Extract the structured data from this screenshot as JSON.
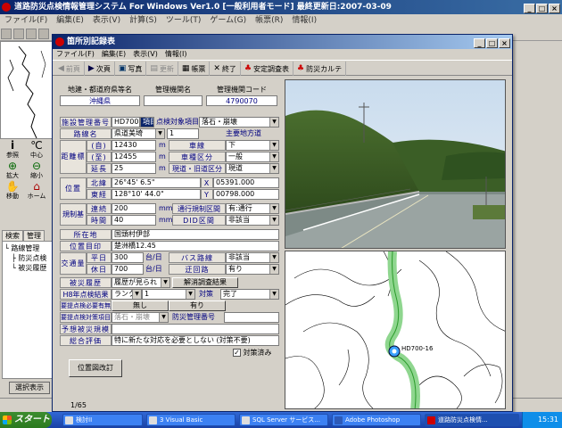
{
  "main_window": {
    "title": "道路防災点検情報管理システム For Windows Ver1.0 [一般利用者モード]  最終更新日:2007-03-09",
    "menu": [
      "ファイル(F)",
      "編集(E)",
      "表示(V)",
      "計算(S)",
      "ツール(T)",
      "ゲーム(G)",
      "帳票(R)",
      "情報(I)"
    ],
    "tools": [
      {
        "label": "参照",
        "icon": "info-icon"
      },
      {
        "label": "中心",
        "icon": "center-icon"
      },
      {
        "label": "拡大",
        "icon": "zoom-in-icon"
      },
      {
        "label": "縮小",
        "icon": "zoom-out-icon"
      },
      {
        "label": "移動",
        "icon": "pan-icon"
      },
      {
        "label": "ホーム",
        "icon": "home-icon"
      }
    ],
    "tree_tabs": [
      "検索",
      "管理"
    ],
    "tree_items": [
      "└ 路線管理",
      "　├ 防災点検",
      "　└ 被災履歴"
    ],
    "bottom_button": "選択表示"
  },
  "dialog": {
    "title": "箇所別記録表",
    "menu": [
      "ファイル(F)",
      "編集(E)",
      "表示(V)",
      "情報(I)"
    ],
    "toolbar": [
      {
        "label": "前頁",
        "icon": "prev-icon",
        "enabled": false
      },
      {
        "label": "次頁",
        "icon": "next-icon",
        "enabled": true
      },
      {
        "label": "写真",
        "icon": "photo-icon",
        "enabled": true
      },
      {
        "label": "更新",
        "icon": "update-icon",
        "enabled": false
      },
      {
        "label": "帳票",
        "icon": "report-icon",
        "enabled": true
      },
      {
        "label": "終了",
        "icon": "close-x-icon",
        "enabled": true
      },
      {
        "label": "安定調査表",
        "icon": "survey-icon",
        "enabled": true
      },
      {
        "label": "防災カルテ",
        "icon": "karte-icon",
        "enabled": true
      }
    ],
    "header": {
      "labels": [
        "地建・都道府県等名",
        "管理機関名",
        "管理機関コード"
      ],
      "values": [
        "沖縄県",
        "",
        "4790070"
      ]
    },
    "form": {
      "facility_no_label": "施設管理番号",
      "facility_no": "HD700",
      "facility_sub": "項目",
      "target_label": "点検対象項目",
      "target_value": "落石・崩壊",
      "route_label": "路線名",
      "route_value": "県道美埼",
      "route_num": "1",
      "main_local": "主要地方道",
      "dist_label": "距離標",
      "dist_from_label": "(自)",
      "dist_from": "12430",
      "dist_to_label": "(至)",
      "dist_to": "12455",
      "length_label": "延長",
      "length": "25",
      "unit_m": "m",
      "lane_label": "車線",
      "lane_value": "下",
      "type_label": "車種区分",
      "type_value": "一般",
      "up_down_label": "現道・旧道区分",
      "up_down_value": "現道",
      "pos_label": "位置",
      "lat_label": "北緯",
      "lat_value": "26°45' 6.5\"",
      "lon_label": "東経",
      "lon_value": "128°10' 44.0\"",
      "x_label": "X",
      "x_value": "05391.000",
      "y_label": "Y",
      "y_value": "00798.000",
      "reg_label": "規制基準",
      "rain_label": "連続",
      "rain_value": "200",
      "unit_mm": "mm",
      "time_label": "時間",
      "time_value": "40",
      "reg_section_label": "通行規制区間",
      "reg_section_value": "有:通行",
      "did_label": "DID区間",
      "did_value": "非該当",
      "location_label": "所在地",
      "location_value": "国頭村伊部",
      "place_label": "位置目印",
      "place_value": "楚洲橋12.45",
      "traffic_label": "交通量",
      "weekday_label": "平日",
      "weekday_value": "300",
      "holiday_label": "休日",
      "holiday_value": "700",
      "unit_per_day": "台/日",
      "bus_label": "バス路線",
      "bus_value": "非該当",
      "detour_label": "迂回路",
      "detour_value": "有り",
      "disaster_label": "被災履歴",
      "disaster_value": "履歴が見られ",
      "disaster_result_label": "解消調査結果",
      "h8_label": "H8年点検結果",
      "h8_value": "ランク",
      "h8_num": "1",
      "measure_label": "対策",
      "measure_value": "完了",
      "need_label": "要提点検必要有無",
      "need_none": "無し",
      "need_yes": "有り",
      "prevent_label": "要提点検対策項目",
      "prevent_value": "落石・崩壊",
      "prevent_no_label": "防災管理番号",
      "forecast_label": "予想被災規模",
      "eval_label": "総合評価",
      "eval_value": "特に新たな対応を必要としない (対策不要)",
      "done_label": "対策済み",
      "position_button": "位置図改訂"
    },
    "map_marker_label": "HD700-16",
    "status_page": "1/65"
  },
  "taskbar": {
    "start": "スタート",
    "tasks": [
      "検討II",
      "3 Visual Basic",
      "SQL Server サービス...",
      "Adobe Photoshop",
      "道路防災点検情..."
    ],
    "clock": "15:31"
  }
}
